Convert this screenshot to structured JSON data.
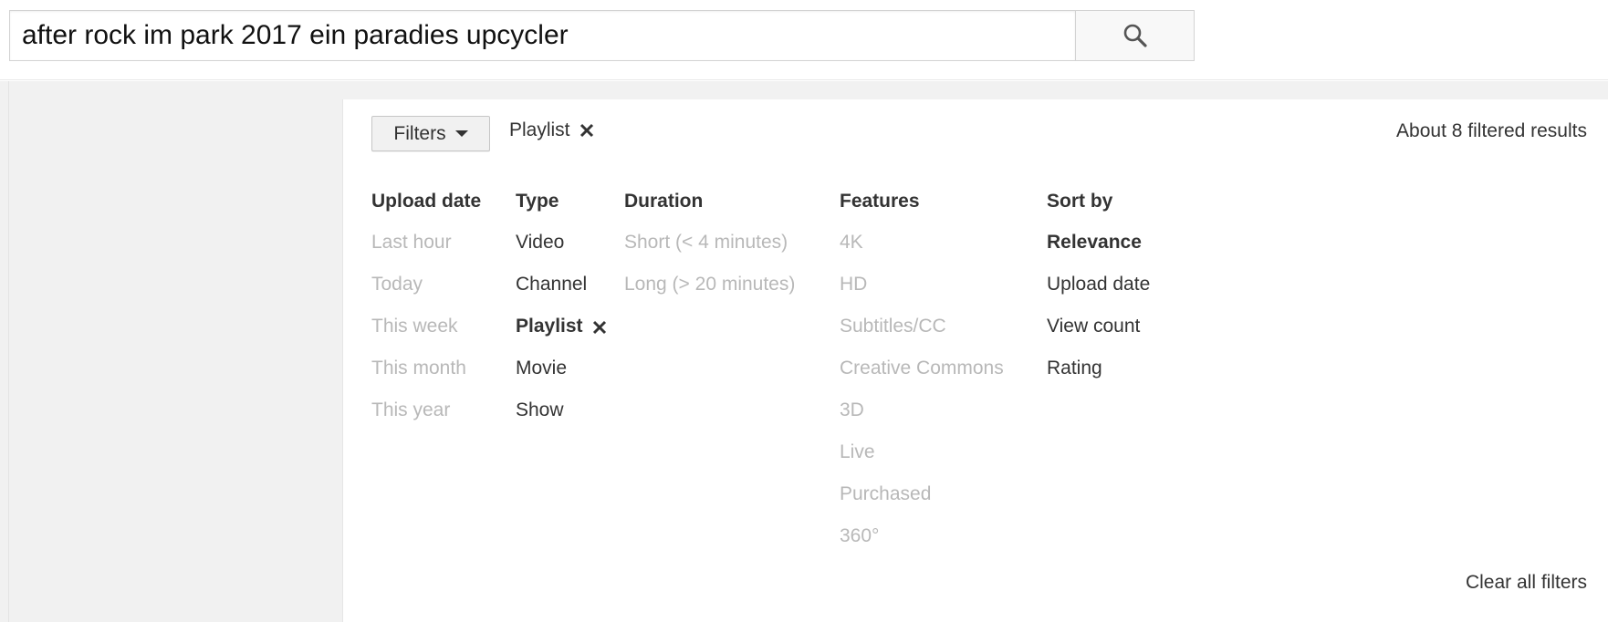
{
  "search": {
    "query": "after rock im park 2017 ein paradies upcycler",
    "button_icon": "search-icon"
  },
  "toolbar": {
    "filters_label": "Filters",
    "active_filter_label": "Playlist",
    "results_text": "About 8 filtered results"
  },
  "columns": {
    "upload_date": {
      "heading": "Upload date",
      "items": [
        "Last hour",
        "Today",
        "This week",
        "This month",
        "This year"
      ]
    },
    "type": {
      "heading": "Type",
      "items": [
        "Video",
        "Channel",
        "Playlist",
        "Movie",
        "Show"
      ]
    },
    "duration": {
      "heading": "Duration",
      "items": [
        "Short (< 4 minutes)",
        "Long (> 20 minutes)"
      ]
    },
    "features": {
      "heading": "Features",
      "items": [
        "4K",
        "HD",
        "Subtitles/CC",
        "Creative Commons",
        "3D",
        "Live",
        "Purchased",
        "360°"
      ]
    },
    "sort_by": {
      "heading": "Sort by",
      "items": [
        "Relevance",
        "Upload date",
        "View count",
        "Rating"
      ]
    }
  },
  "footer": {
    "clear_all_label": "Clear all filters"
  },
  "colors": {
    "text": "#333333",
    "disabled_text": "#b8b8b8",
    "page_background": "#f1f1f1"
  }
}
